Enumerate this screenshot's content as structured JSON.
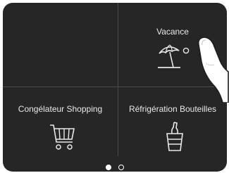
{
  "tiles": {
    "vacance": {
      "label": "Vacance",
      "icon": "beach-umbrella-icon",
      "indicator_icon": "circle-outline-icon"
    },
    "shopping": {
      "label": "Congélateur Shopping",
      "icon": "shopping-cart-icon"
    },
    "bottles": {
      "label": "Réfrigération Bouteilles",
      "icon": "bottle-bucket-icon"
    }
  },
  "pager": {
    "pages": 2,
    "current": 1
  },
  "colors": {
    "background": "#262626",
    "divider": "#4a4a4a",
    "text": "#e9e9e9",
    "active": "#ffffff"
  }
}
